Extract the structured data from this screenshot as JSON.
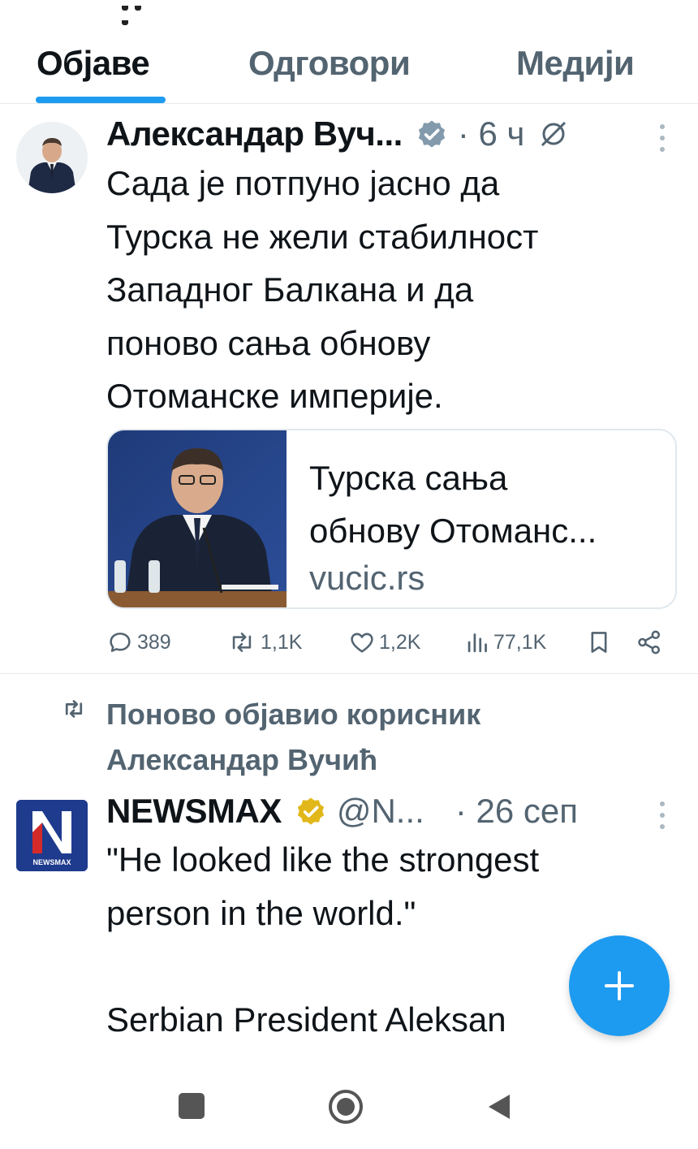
{
  "tabs": [
    {
      "label": "Објаве",
      "active": true
    },
    {
      "label": "Одговори",
      "active": false
    },
    {
      "label": "Медији",
      "active": false
    }
  ],
  "tweet1": {
    "author": "Александар Вуч...",
    "time": "· 6 ч",
    "verified_color": "#829aab",
    "text_lines": [
      "Сада је потпуно јасно да",
      "Турска не жели стабилност",
      "Западног Балкана и да",
      "поново сања обнову",
      "Отоманске империје."
    ],
    "card": {
      "title_lines": [
        "Турска сања",
        "обнову Отоманс..."
      ],
      "domain": "vucic.rs"
    },
    "actions": {
      "replies": "389",
      "retweets": "1,1K",
      "likes": "1,2K",
      "views": "77,1K"
    }
  },
  "tweet2": {
    "retweeted_by_lines": [
      "Поново објавио корисник",
      "Александар Вучић"
    ],
    "author": "NEWSMAX",
    "handle": "@N...",
    "time": "· 26 сеп",
    "verified_color": "#e2b719",
    "avatar_text": "NEWSMAX",
    "text_lines": [
      "\"He looked like the strongest",
      "person in the world.\"",
      "",
      "Serbian President Aleksan"
    ]
  },
  "colors": {
    "accent": "#1d9bf0",
    "secondary_text": "#536471"
  },
  "icons": {
    "reply": "reply-icon",
    "retweet": "retweet-icon",
    "like": "heart-icon",
    "views": "views-icon",
    "bookmark": "bookmark-icon",
    "share": "share-icon",
    "compose": "plus-icon"
  }
}
